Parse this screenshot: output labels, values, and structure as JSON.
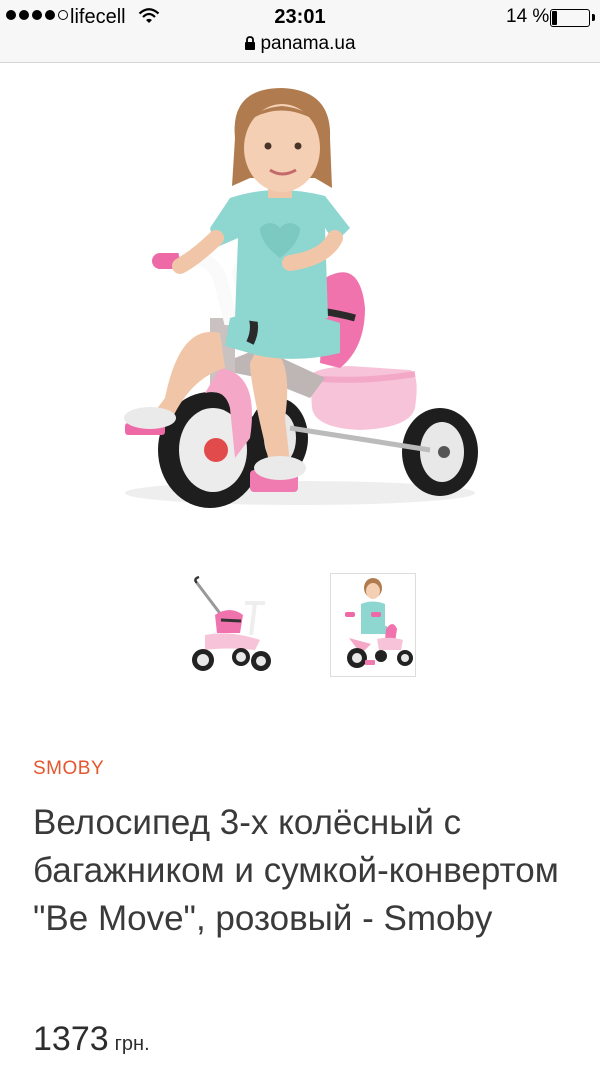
{
  "status_bar": {
    "carrier": "lifecell",
    "time": "23:01",
    "battery": "14 %",
    "battery_level": 0.14
  },
  "browser": {
    "url": "panama.ua"
  },
  "product": {
    "brand": "SMOBY",
    "title": "Велосипед 3-х колёсный с багажником и сумкой-конвертом \"Be Move\", розовый - Smoby",
    "price": "1373",
    "currency": "грн."
  },
  "colors": {
    "brand": "#e4572e",
    "pink": "#f3a8c8",
    "mint": "#8ed6d0"
  }
}
